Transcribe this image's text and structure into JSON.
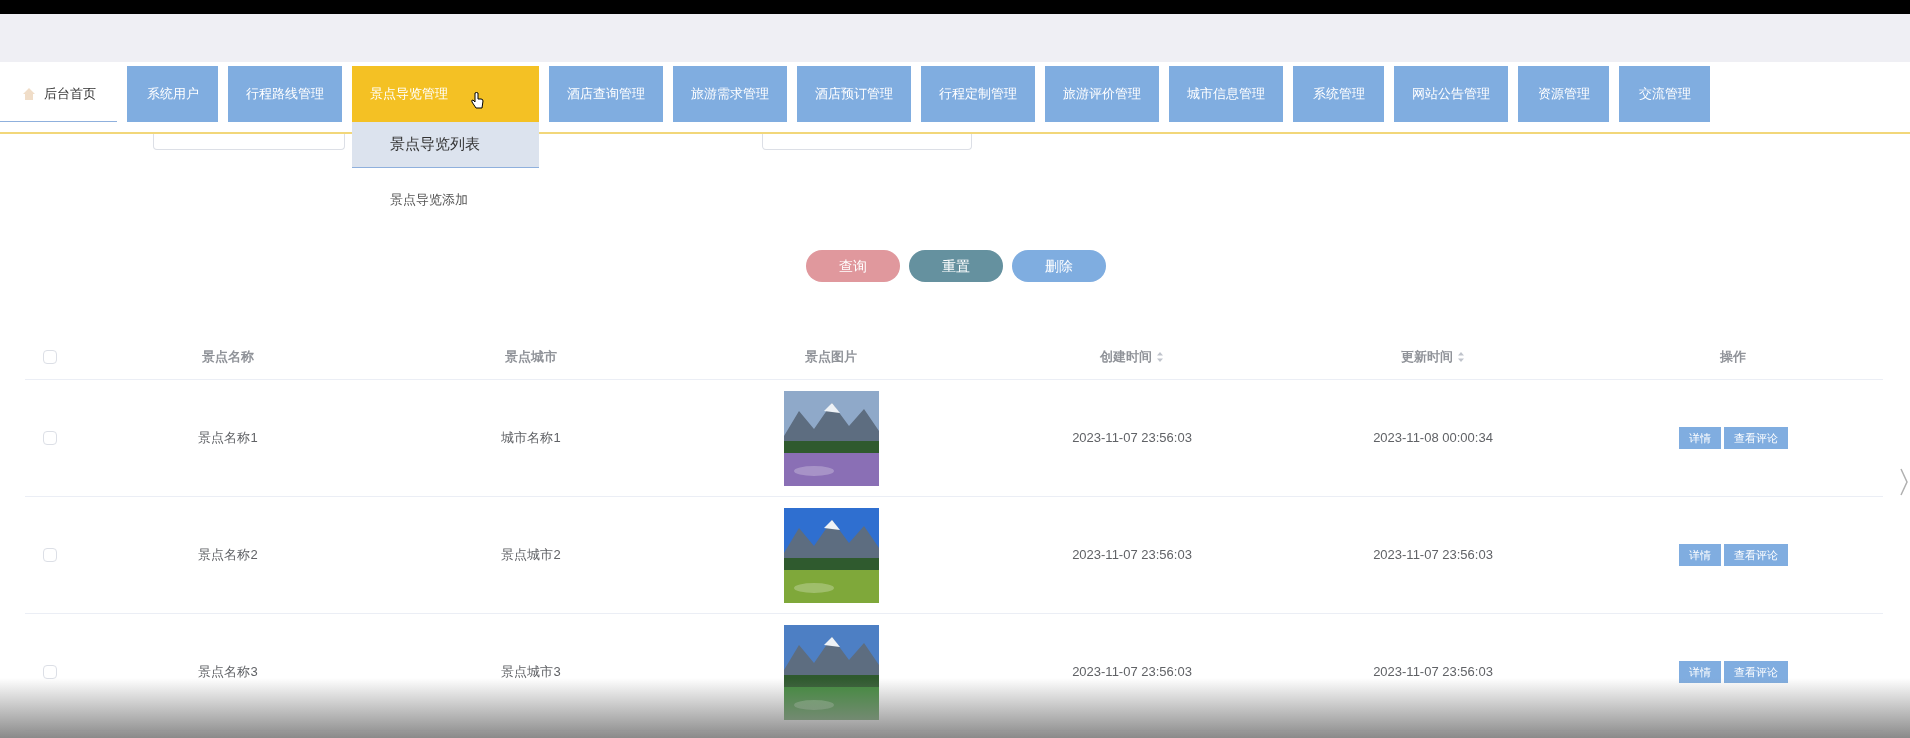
{
  "nav": {
    "home": {
      "label": "后台首页"
    },
    "items": [
      {
        "label": "系统用户",
        "selected": false
      },
      {
        "label": "行程路线管理",
        "selected": false
      },
      {
        "label": "景点导览管理",
        "selected": true,
        "submenu": [
          {
            "label": "景点导览列表",
            "selected": true
          },
          {
            "label": "景点导览添加",
            "selected": false
          }
        ]
      },
      {
        "label": "酒店查询管理",
        "selected": false
      },
      {
        "label": "旅游需求管理",
        "selected": false
      },
      {
        "label": "酒店预订管理",
        "selected": false
      },
      {
        "label": "行程定制管理",
        "selected": false
      },
      {
        "label": "旅游评价管理",
        "selected": false
      },
      {
        "label": "城市信息管理",
        "selected": false
      },
      {
        "label": "系统管理",
        "selected": false
      },
      {
        "label": "网站公告管理",
        "selected": false
      },
      {
        "label": "资源管理",
        "selected": false
      },
      {
        "label": "交流管理",
        "selected": false
      }
    ]
  },
  "actions": [
    {
      "label": "查询",
      "kind": "search"
    },
    {
      "label": "重置",
      "kind": "reset"
    },
    {
      "label": "删除",
      "kind": "delete"
    }
  ],
  "table": {
    "all_checked": false,
    "columns": [
      {
        "label": "景点名称",
        "sortable": false
      },
      {
        "label": "景点城市",
        "sortable": false
      },
      {
        "label": "景点图片",
        "sortable": false
      },
      {
        "label": "创建时间",
        "sortable": true
      },
      {
        "label": "更新时间",
        "sortable": true
      },
      {
        "label": "操作",
        "sortable": false
      }
    ],
    "rows": [
      {
        "checked": false,
        "name": "景点名称1",
        "city": "城市名称1",
        "image": {
          "kind": "picture"
        },
        "created": "2023-11-07 23:56:03",
        "updated": "2023-11-08 00:00:34",
        "buttons": [
          "详情",
          "查看评论"
        ]
      },
      {
        "checked": false,
        "name": "景点名称2",
        "city": "景点城市2",
        "image": {
          "kind": "picture"
        },
        "created": "2023-11-07 23:56:03",
        "updated": "2023-11-07 23:56:03",
        "buttons": [
          "详情",
          "查看评论"
        ]
      },
      {
        "checked": false,
        "name": "景点名称3",
        "city": "景点城市3",
        "image": {
          "kind": "picture"
        },
        "created": "2023-11-07 23:56:03",
        "updated": "2023-11-07 23:56:03",
        "buttons": [
          "详情",
          "查看评论"
        ]
      }
    ]
  }
}
